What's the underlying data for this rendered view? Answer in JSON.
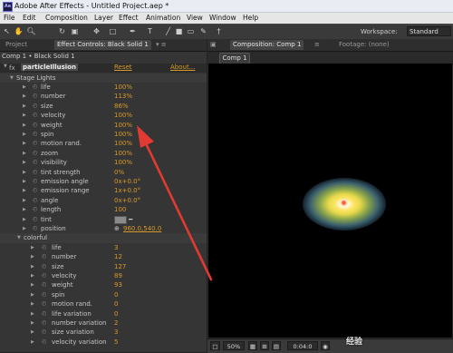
{
  "window": {
    "title": "Adobe After Effects - Untitled Project.aep *",
    "app_icon": "Ae"
  },
  "menu": [
    "File",
    "Edit",
    "Composition",
    "Layer",
    "Effect",
    "Animation",
    "View",
    "Window",
    "Help"
  ],
  "toolbar": {
    "tools": [
      "selection-icon",
      "hand-icon",
      "zoom-icon",
      "rotate-icon",
      "camera-icon",
      "pan-behind-icon",
      "rectangle-mask-icon",
      "pen-icon",
      "text-icon",
      "brush-icon",
      "clone-stamp-icon",
      "eraser-icon",
      "roto-brush-icon",
      "puppet-pin-icon"
    ],
    "workspace_label": "Workspace:",
    "workspace_value": "Standard"
  },
  "left_tabs": {
    "project": "Project",
    "effect_controls": "Effect Controls: Black Solid 1"
  },
  "right_tabs": {
    "composition": "Composition: Comp 1",
    "footage": "Footage: (none)"
  },
  "breadcrumb": "Comp 1 • Black Solid 1",
  "effect": {
    "fx": "fx",
    "name": "particleIllusion",
    "reset": "Reset",
    "about": "About..."
  },
  "stage_lights": {
    "label": "Stage Lights",
    "params": [
      {
        "label": "life",
        "value": "100%"
      },
      {
        "label": "number",
        "value": "113%"
      },
      {
        "label": "size",
        "value": "86%"
      },
      {
        "label": "velocity",
        "value": "100%"
      },
      {
        "label": "weight",
        "value": "100%"
      },
      {
        "label": "spin",
        "value": "100%"
      },
      {
        "label": "motion rand.",
        "value": "100%"
      },
      {
        "label": "zoom",
        "value": "100%"
      },
      {
        "label": "visibility",
        "value": "100%"
      },
      {
        "label": "tint strength",
        "value": "0%"
      },
      {
        "label": "emission angle",
        "value": "0x+0.0°"
      },
      {
        "label": "emission range",
        "value": "1x+0.0°"
      },
      {
        "label": "angle",
        "value": "0x+0.0°"
      },
      {
        "label": "length",
        "value": "100"
      },
      {
        "label": "tint",
        "value": ""
      },
      {
        "label": "position",
        "value": "960.0,540.0"
      }
    ]
  },
  "colorful": {
    "label": "colorful",
    "params": [
      {
        "label": "life",
        "value": "3"
      },
      {
        "label": "number",
        "value": "12"
      },
      {
        "label": "size",
        "value": "127"
      },
      {
        "label": "velocity",
        "value": "89"
      },
      {
        "label": "weight",
        "value": "93"
      },
      {
        "label": "spin",
        "value": "0"
      },
      {
        "label": "motion rand.",
        "value": "0"
      },
      {
        "label": "life variation",
        "value": "0"
      },
      {
        "label": "number variation",
        "value": "2"
      },
      {
        "label": "size variation",
        "value": "3"
      },
      {
        "label": "velocity variation",
        "value": "5"
      }
    ]
  },
  "comp_viewer": {
    "tab": "Comp 1",
    "zoom": "50%",
    "time": "0:04:0"
  },
  "watermark": "经验",
  "colors": {
    "accent_value": "#d89a2a",
    "arrow": "#e03a32"
  }
}
